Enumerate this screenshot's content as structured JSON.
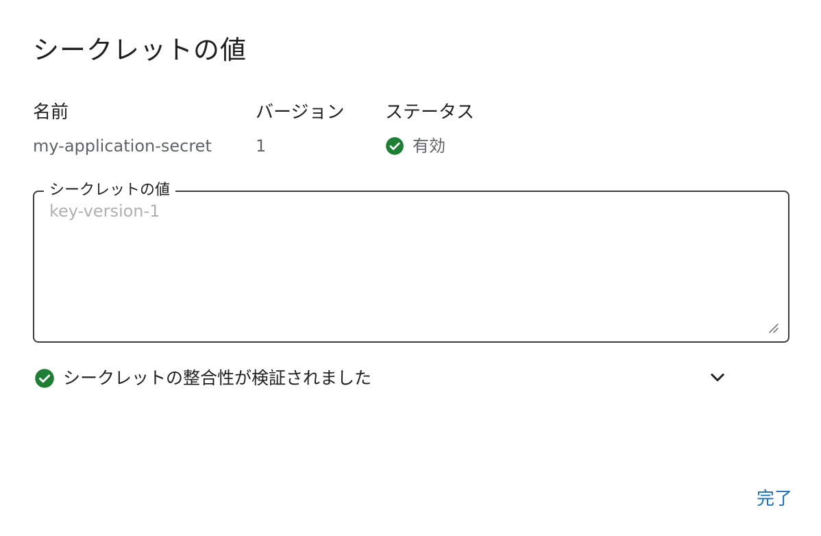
{
  "dialog": {
    "title": "シークレットの値"
  },
  "info": {
    "name_label": "名前",
    "name_value": "my-application-secret",
    "version_label": "バージョン",
    "version_value": "1",
    "status_label": "ステータス",
    "status_value": "有効",
    "status_icon": "check-circle-icon",
    "status_color": "#1e7e34"
  },
  "secret_field": {
    "label": "シークレットの値",
    "placeholder": "key-version-1",
    "value": ""
  },
  "verification": {
    "text": "シークレットの整合性が検証されました",
    "icon": "check-circle-icon",
    "expand_icon": "chevron-down-icon"
  },
  "actions": {
    "done_label": "完了",
    "accent_color": "#1a6fb5"
  }
}
